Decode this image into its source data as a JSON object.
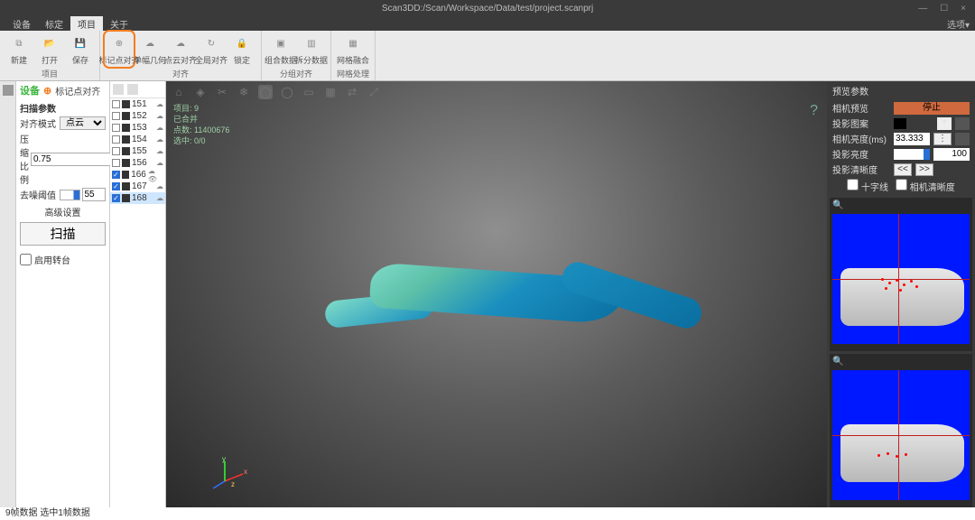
{
  "title": "Scan3DD:/Scan/Workspace/Data/test/project.scanprj",
  "menu": {
    "items": [
      "设备",
      "标定",
      "项目",
      "关于"
    ],
    "active_index": 2,
    "options": "选项▾"
  },
  "ribbon": {
    "groups": [
      {
        "label": "项目",
        "buttons": [
          {
            "name": "new-button",
            "label": "新建",
            "icon": "⧉"
          },
          {
            "name": "open-button",
            "label": "打开",
            "icon": "📂"
          },
          {
            "name": "save-button",
            "label": "保存",
            "icon": "💾"
          }
        ]
      },
      {
        "label": "对齐",
        "buttons": [
          {
            "name": "marker-align-button",
            "label": "标记点对齐",
            "icon": "⊕",
            "hl": true
          },
          {
            "name": "single-geom-button",
            "label": "单幅几何",
            "icon": "☁"
          },
          {
            "name": "cloud-align-button",
            "label": "点云对齐",
            "icon": "☁"
          },
          {
            "name": "global-align-button",
            "label": "全局对齐",
            "icon": "↻"
          },
          {
            "name": "lock-button",
            "label": "锁定",
            "icon": "🔒"
          }
        ]
      },
      {
        "label": "分组对齐",
        "buttons": [
          {
            "name": "merge-data-button",
            "label": "组合数据",
            "icon": "▣"
          },
          {
            "name": "split-data-button",
            "label": "拆分数据",
            "icon": "▥"
          }
        ]
      },
      {
        "label": "网格处理",
        "buttons": [
          {
            "name": "mesh-fuse-button",
            "label": "网格融合",
            "icon": "▦"
          }
        ]
      }
    ]
  },
  "scanpanel": {
    "header_device": "设备",
    "header_tag": "标记点对齐",
    "section": "扫描参数",
    "align_mode_label": "对齐模式",
    "align_mode_value": "点云",
    "compress_label": "压缩比例",
    "compress_value": "0.75",
    "denoise_label": "去噪阈值",
    "denoise_value": "55",
    "advanced": "高级设置",
    "scan_btn": "扫描",
    "turntable_label": "启用转台"
  },
  "scanlist": {
    "items": [
      {
        "num": "151",
        "checked": false
      },
      {
        "num": "152",
        "checked": false
      },
      {
        "num": "153",
        "checked": false
      },
      {
        "num": "154",
        "checked": false
      },
      {
        "num": "155",
        "checked": false
      },
      {
        "num": "156",
        "checked": false
      },
      {
        "num": "166",
        "checked": true,
        "extra": "👁"
      },
      {
        "num": "167",
        "checked": true
      },
      {
        "num": "168",
        "checked": true,
        "active": true
      }
    ]
  },
  "viewport": {
    "stats_line1": "项目: 9",
    "stats_line2": "已合并",
    "stats_points": "点数: 11400676",
    "stats_sel": "选中: 0/0",
    "help": "?",
    "axis": {
      "x": "x",
      "y": "y",
      "z": "z"
    }
  },
  "rightpanel": {
    "title": "预览参数",
    "cam_preview": "相机预览",
    "stop": "停止",
    "proj_pattern": "投影图案",
    "cam_brightness": "相机亮度(ms)",
    "cam_brightness_val": "33.333",
    "proj_brightness": "投影亮度",
    "proj_brightness_val": "100",
    "proj_sharp": "投影清晰度",
    "prev": "<<",
    "next": ">>",
    "crosshair": "十字线",
    "cam_sharp": "相机清晰度"
  },
  "status": "9帧数据  选中1帧数据"
}
